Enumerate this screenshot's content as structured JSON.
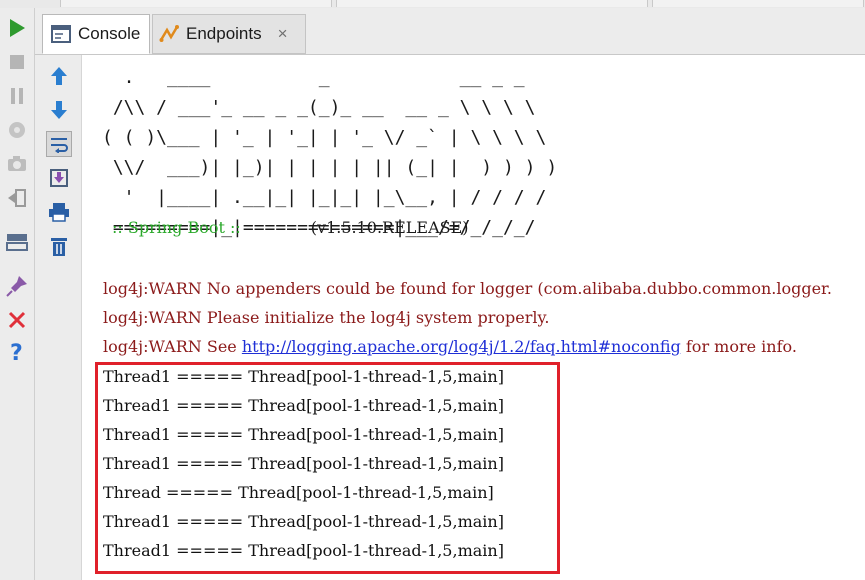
{
  "tabs": {
    "console_label": "Console",
    "endpoints_label": "Endpoints",
    "close_symbol": "×"
  },
  "left_toolbar": [
    {
      "name": "run-icon"
    },
    {
      "name": "stop-icon"
    },
    {
      "name": "pause-icon"
    },
    {
      "name": "dump-threads-icon"
    },
    {
      "name": "camera-icon"
    },
    {
      "name": "exit-icon"
    },
    {
      "name": "layout-icon"
    },
    {
      "name": "pin-icon"
    },
    {
      "name": "close-icon"
    },
    {
      "name": "help-icon"
    }
  ],
  "console_toolbar": [
    {
      "name": "up-arrow-icon"
    },
    {
      "name": "down-arrow-icon"
    },
    {
      "name": "soft-wrap-icon"
    },
    {
      "name": "scroll-to-end-icon"
    },
    {
      "name": "print-icon"
    },
    {
      "name": "clear-all-icon"
    }
  ],
  "console": {
    "banner": "  .   ____          _            __ _ _\n /\\\\ / ___'_ __ _ _(_)_ __  __ _ \\ \\ \\ \\\n( ( )\\___ | '_ | '_| | '_ \\/ _` | \\ \\ \\ \\\n \\\\/  ___)| |_)| | | | | || (_| |  ) ) ) )\n  '  |____| .__|_| |_|_| |_\\__, | / / / /\n =========|_|==============|___/=/_/_/_/",
    "spring_boot_label": ":: Spring Boot ::",
    "spring_boot_version": "(v1.5.10.RELEASE)",
    "log_lines": [
      "log4j:WARN No appenders could be found for logger (com.alibaba.dubbo.common.logger.",
      "log4j:WARN Please initialize the log4j system properly."
    ],
    "log_see_prefix": "log4j:WARN See ",
    "log_see_link": "http://logging.apache.org/log4j/1.2/faq.html#noconfig",
    "log_see_suffix": " for more info.",
    "thread_lines": [
      "Thread1 ===== Thread[pool-1-thread-1,5,main]",
      "Thread1 ===== Thread[pool-1-thread-1,5,main]",
      "Thread1 ===== Thread[pool-1-thread-1,5,main]",
      "Thread1 ===== Thread[pool-1-thread-1,5,main]",
      "Thread ===== Thread[pool-1-thread-1,5,main]",
      "Thread1 ===== Thread[pool-1-thread-1,5,main]",
      "Thread1 ===== Thread[pool-1-thread-1,5,main]"
    ]
  },
  "colors": {
    "accent_green": "#2aa82a",
    "warn_red": "#8b1a1a",
    "link_blue": "#1f2fd6",
    "highlight_red": "#e0202a"
  }
}
